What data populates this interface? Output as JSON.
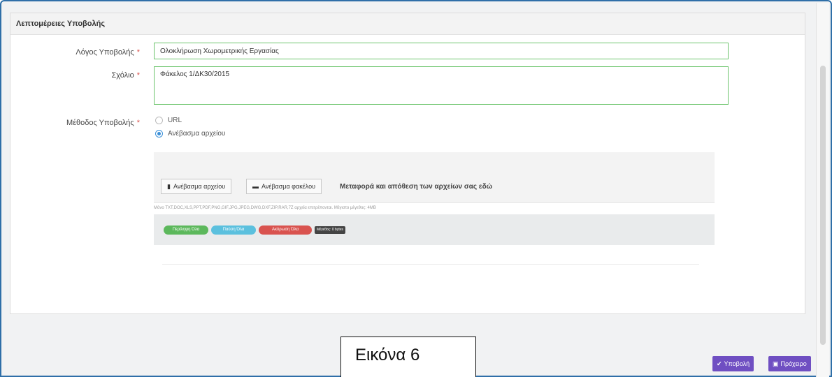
{
  "panel": {
    "title": "Λεπτομέρειες Υποβολής"
  },
  "form": {
    "reason_label": "Λόγος Υποβολής",
    "reason_value": "Ολοκλήρωση Χωρομετρικής Εργασίας",
    "comment_label": "Σχόλιο",
    "comment_value": "Φάκελος 1/ΔΚ30/2015",
    "method_label": "Μέθοδος Υποβολής",
    "required_mark": "*",
    "method_options": [
      {
        "label": "URL",
        "checked": false
      },
      {
        "label": "Ανέβασμα αρχείου",
        "checked": true
      }
    ]
  },
  "upload": {
    "file_button": "Ανέβασμα αρχείου",
    "folder_button": "Ανέβασμα φακέλου",
    "drop_text": "Μεταφορά και απόθεση των αρχείων σας εδώ",
    "hint": "Μόνο TXT,DOC,XLS,PPT,PDF,PNG,GIF,JPG,JPEG,DWG,DXF,ZIP,RAR,7Z αρχεία επιτρέπονται. Μέγιστο μέγεθος: 4MB",
    "pills": [
      {
        "label": "Περίληψη Όλα",
        "color": "#5cb85c"
      },
      {
        "label": "Παύση Όλα",
        "color": "#5bc0de"
      },
      {
        "label": "Ακύρωση Όλα",
        "color": "#d9534f"
      }
    ],
    "size_badge": "Μέγεθος: 0 bytes"
  },
  "caption": "Εικόνα 6",
  "actions": {
    "submit": "Υποβολή",
    "draft": "Πρόχειρο",
    "color": "#6f4fc2"
  }
}
